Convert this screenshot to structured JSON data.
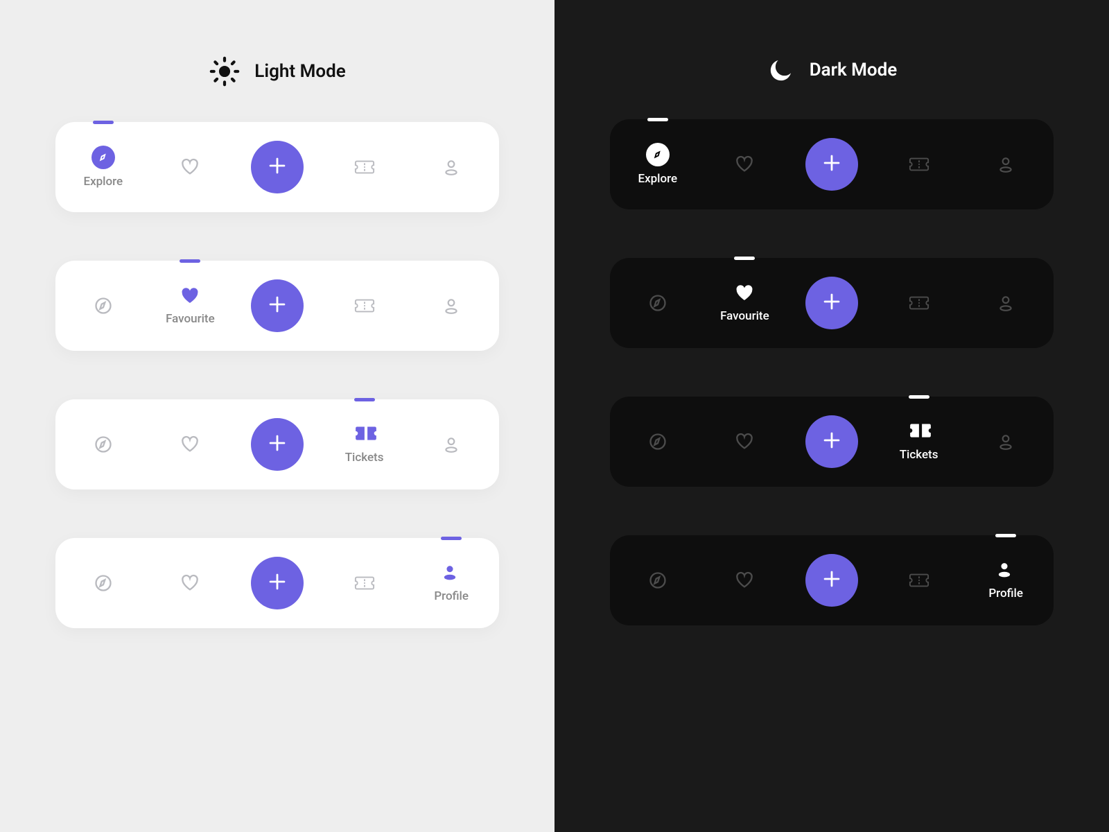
{
  "light": {
    "title": "Light Mode",
    "bg": "#EEEEEE",
    "bar_bg": "#FFFFFF",
    "active_color": "#6D62E2",
    "inactive_color": "#B9BABF",
    "indicator_color": "#6D62E2"
  },
  "dark": {
    "title": "Dark Mode",
    "bg": "#1A1A1A",
    "bar_bg": "#0E0E0E",
    "active_color": "#FFFFFF",
    "inactive_color": "#4C4C4C",
    "indicator_color": "#FFFFFF"
  },
  "fab_color": "#6D62E2",
  "nav": {
    "explore": {
      "label": "Explore",
      "icon": "compass-icon"
    },
    "favourite": {
      "label": "Favourite",
      "icon": "heart-icon"
    },
    "add": {
      "label": "",
      "icon": "plus-icon"
    },
    "tickets": {
      "label": "Tickets",
      "icon": "ticket-icon"
    },
    "profile": {
      "label": "Profile",
      "icon": "user-icon"
    }
  },
  "bars": [
    {
      "active": "explore"
    },
    {
      "active": "favourite"
    },
    {
      "active": "tickets"
    },
    {
      "active": "profile"
    }
  ]
}
